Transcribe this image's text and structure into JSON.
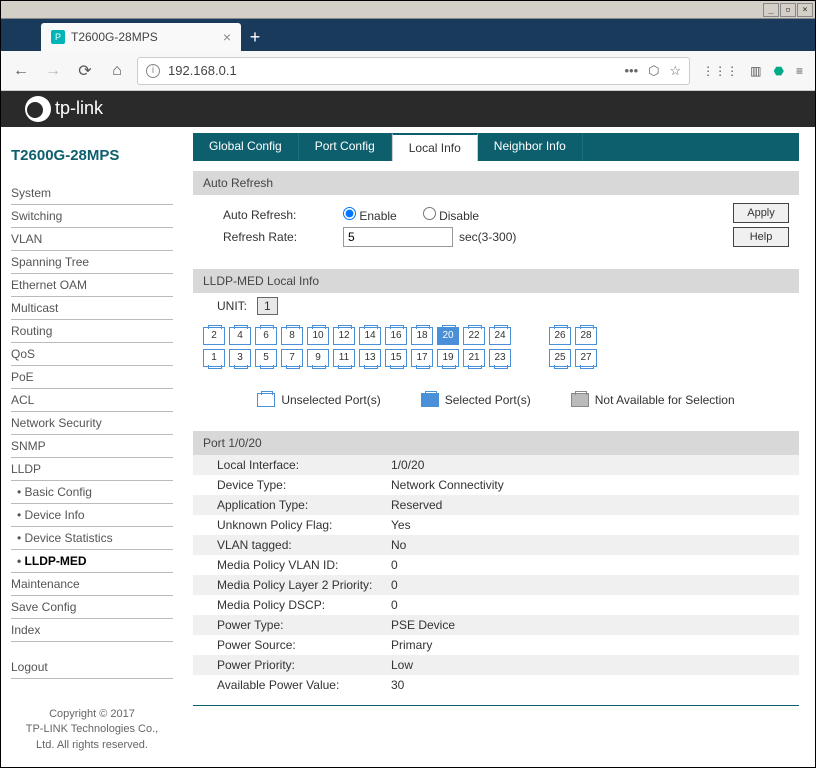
{
  "browser": {
    "tab_title": "T2600G-28MPS",
    "url": "192.168.0.1"
  },
  "brand": "tp-link",
  "model": "T2600G-28MPS",
  "sidebar": {
    "items": [
      "System",
      "Switching",
      "VLAN",
      "Spanning Tree",
      "Ethernet OAM",
      "Multicast",
      "Routing",
      "QoS",
      "PoE",
      "ACL",
      "Network Security",
      "SNMP",
      "LLDP"
    ],
    "sub_items": [
      "Basic Config",
      "Device Info",
      "Device Statistics",
      "LLDP-MED"
    ],
    "items2": [
      "Maintenance",
      "Save Config",
      "Index"
    ],
    "logout": "Logout",
    "copyright": "Copyright © 2017\nTP-LINK Technologies Co.,\nLtd. All rights reserved."
  },
  "tabs": [
    "Global Config",
    "Port Config",
    "Local Info",
    "Neighbor Info"
  ],
  "active_tab": 2,
  "auto_refresh": {
    "header": "Auto Refresh",
    "label": "Auto Refresh:",
    "enable": "Enable",
    "disable": "Disable",
    "rate_label": "Refresh Rate:",
    "rate_value": "5",
    "rate_hint": "sec(3-300)",
    "apply": "Apply",
    "help": "Help"
  },
  "lldp": {
    "header": "LLDP-MED Local Info",
    "unit_label": "UNIT:",
    "unit_value": "1",
    "ports_top": [
      "2",
      "4",
      "6",
      "8",
      "10",
      "12",
      "14",
      "16",
      "18",
      "20",
      "22",
      "24"
    ],
    "ports_bottom": [
      "1",
      "3",
      "5",
      "7",
      "9",
      "11",
      "13",
      "15",
      "17",
      "19",
      "21",
      "23"
    ],
    "ports_rt_top": [
      "26",
      "28"
    ],
    "ports_rt_bot": [
      "25",
      "27"
    ],
    "selected_port": "20",
    "legend": {
      "unsel": "Unselected Port(s)",
      "sel": "Selected Port(s)",
      "na": "Not Available for Selection"
    }
  },
  "port_info": {
    "header": "Port 1/0/20",
    "rows": [
      [
        "Local Interface:",
        "1/0/20"
      ],
      [
        "Device Type:",
        "Network Connectivity"
      ],
      [
        "Application Type:",
        "Reserved"
      ],
      [
        "Unknown Policy Flag:",
        "Yes"
      ],
      [
        "VLAN tagged:",
        "No"
      ],
      [
        "Media Policy VLAN ID:",
        "0"
      ],
      [
        "Media Policy Layer 2 Priority:",
        "0"
      ],
      [
        "Media Policy DSCP:",
        "0"
      ],
      [
        "Power Type:",
        "PSE Device"
      ],
      [
        "Power Source:",
        "Primary"
      ],
      [
        "Power Priority:",
        "Low"
      ],
      [
        "Available Power Value:",
        "30"
      ]
    ]
  }
}
